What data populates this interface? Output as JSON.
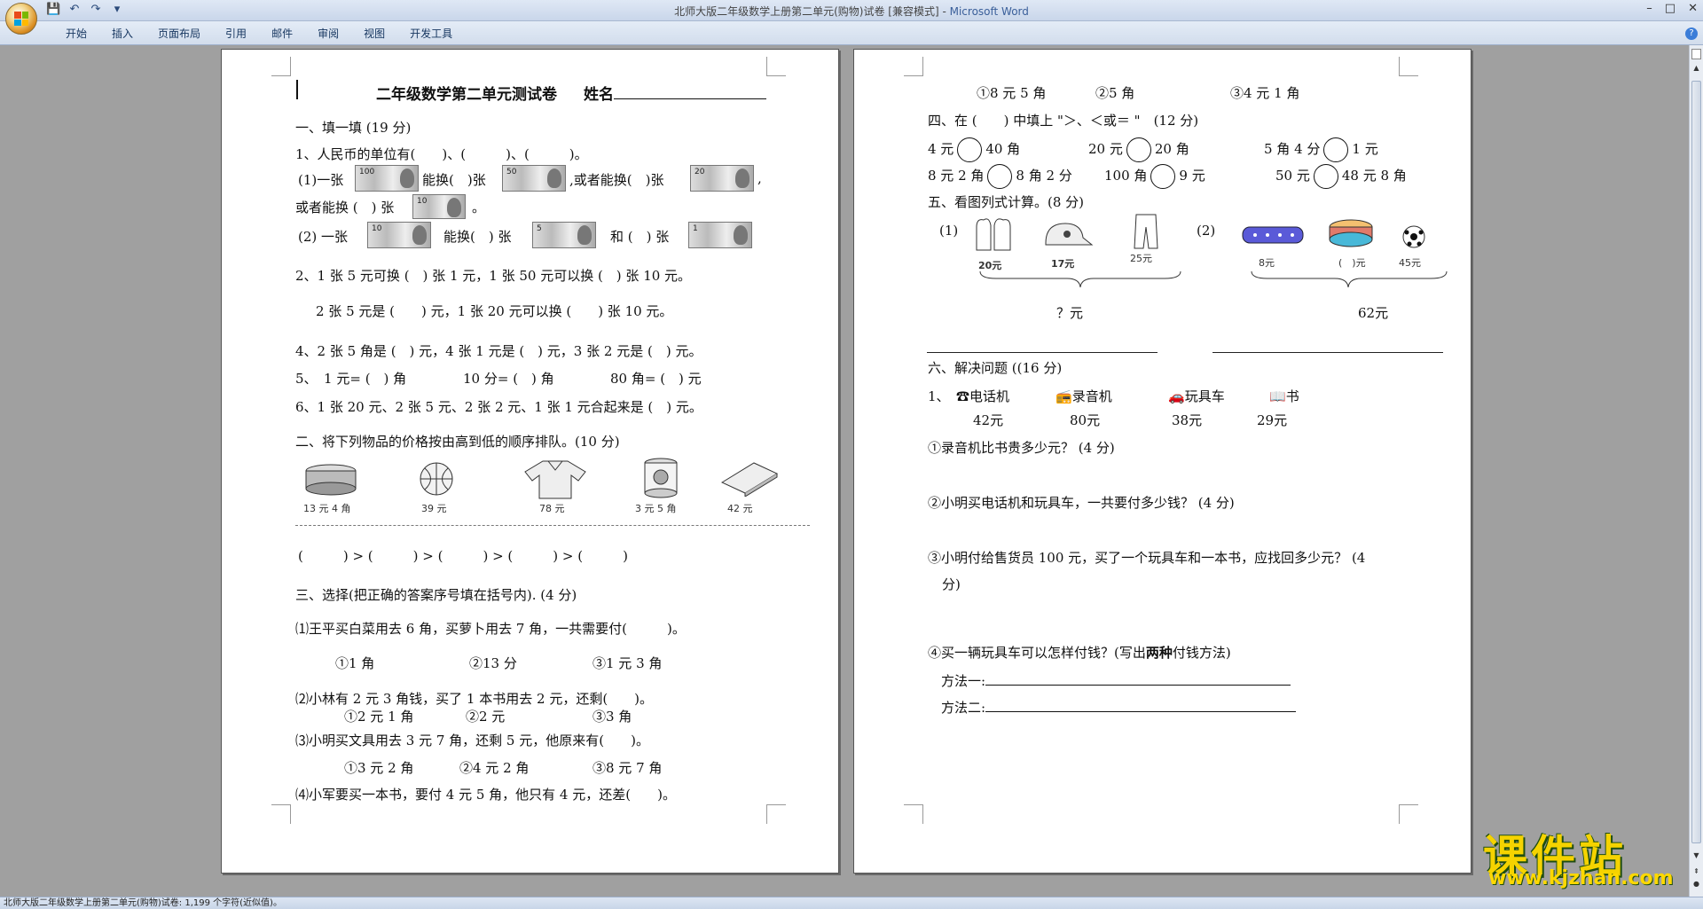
{
  "window": {
    "title": "北师大版二年级数学上册第二单元(购物)试卷 [兼容模式]",
    "app_name": "Microsoft Word",
    "separator": " - ",
    "controls": [
      "–",
      "□",
      "✕"
    ]
  },
  "quick_access": [
    {
      "icon": "save-icon",
      "glyph": "💾"
    },
    {
      "icon": "undo-icon",
      "glyph": "↶"
    },
    {
      "icon": "redo-icon",
      "glyph": "↷"
    },
    {
      "icon": "customize-icon",
      "glyph": "▾"
    }
  ],
  "ribbon_tabs": [
    "开始",
    "插入",
    "页面布局",
    "引用",
    "邮件",
    "审阅",
    "视图",
    "开发工具"
  ],
  "statusbar": {
    "text": "北师大版二年级数学上册第二单元(购物)试卷: 1,199 个字符(近似值)。"
  },
  "page1": {
    "title": "二年级数学第二单元测试卷",
    "name_label": "姓名",
    "s1_heading": "一、填一填 (19 分)",
    "q1": "1、人民币的单位有(　　)、(　　　)、(　　　)。",
    "q1_1a": "(1)一张",
    "q1_1b": "能换(　)张",
    "q1_1c": ",或者能换(　)张",
    "q1_1d": ",",
    "q1_1e": "或者能换 (　) 张",
    "q1_1f": "。",
    "q1_2a": "(2) 一张",
    "q1_2b": "能换(　) 张",
    "q1_2c": "和 (　) 张",
    "q2": "2、1 张 5 元可换 (　) 张 1 元，1 张 50 元可以换 (　) 张 10 元。",
    "q3": "2 张 5 元是 (　　) 元，1 张 20 元可以换 (　　) 张 10 元。",
    "q4": "4、2 张 5 角是 (　) 元，4 张 1 元是 (　) 元，3 张 2 元是 (　) 元。",
    "q5a": "5、　1 元= (　) 角",
    "q5b": "10 分= (　) 角",
    "q5c": "80 角= (　) 元",
    "q6": "6、1 张 20 元、2 张 5 元、2 张 2 元、1 张 1 元合起来是 (　) 元。",
    "s2_heading": "二、将下列物品的价格按由高到低的顺序排队。(10 分)",
    "items": [
      {
        "name": "can",
        "price": "13 元 4 角"
      },
      {
        "name": "basketball",
        "price": "39 元"
      },
      {
        "name": "shirt",
        "price": "78 元"
      },
      {
        "name": "milk-can",
        "price": "3 元 5 角"
      },
      {
        "name": "book-box",
        "price": "42 元"
      }
    ],
    "order_line": "(　　　) > (　　　) > (　　　) > (　　　) > (　　　)",
    "s3_heading": "三、选择(把正确的答案序号填在括号内). (4 分)",
    "c1": "⑴王平买白菜用去 6 角，买萝卜用去 7 角，一共需要付(　　　)。",
    "c1_opts": [
      "①1 角",
      "②13 分",
      "③1 元 3 角"
    ],
    "c2": "⑵小林有 2 元 3 角钱，买了 1 本书用去 2 元，还剩(　　)。",
    "c2_opts": [
      "①2 元 1 角",
      "②2 元",
      "③3 角"
    ],
    "c3": "⑶小明买文具用去 3 元 7 角，还剩 5 元，他原来有(　　)。",
    "c3_opts": [
      "①3 元 2 角",
      "②4 元 2 角",
      "③8 元 7 角"
    ],
    "c4": "⑷小军要买一本书，要付 4 元 5 角，他只有 4 元，还差(　　)。"
  },
  "page2": {
    "c4_opts": [
      "①8 元 5 角",
      "②5 角",
      "③4 元 1 角"
    ],
    "s4_heading": "四、在 (　　) 中填上 \"＞、＜或＝ \"　(12 分)",
    "cmp_row1": [
      [
        "4 元",
        "40 角"
      ],
      [
        "20 元",
        "20 角"
      ],
      [
        "5 角 4 分",
        "1 元"
      ]
    ],
    "cmp_row2": [
      [
        "8 元 2 角",
        "8 角 2 分"
      ],
      [
        "100 角",
        "9 元"
      ],
      [
        "50 元",
        "48 元 8 角"
      ]
    ],
    "s5_heading": "五、看图列式计算。(8 分)",
    "p1_label": "(1)",
    "p1_items": [
      {
        "name": "gloves",
        "price": "20元"
      },
      {
        "name": "cap",
        "price": "17元"
      },
      {
        "name": "pants",
        "price": "25元"
      }
    ],
    "p1_total": "？元",
    "p2_label": "(2)",
    "p2_items": [
      {
        "name": "pencil-case",
        "price": "8元"
      },
      {
        "name": "cake",
        "price": "(　)元"
      },
      {
        "name": "football",
        "price": "45元"
      }
    ],
    "p2_total": "62元",
    "s6_heading": "六、解决问题 ((16 分)",
    "s6_q_num": "1、",
    "s6_items": [
      {
        "name": "电话机",
        "icon": "phone-icon",
        "glyph": "☎",
        "price": "42元"
      },
      {
        "name": "录音机",
        "icon": "recorder-icon",
        "glyph": "📻",
        "price": "80元"
      },
      {
        "name": "玩具车",
        "icon": "toy-car-icon",
        "glyph": "🚗",
        "price": "38元"
      },
      {
        "name": "书",
        "icon": "book-icon",
        "glyph": "📖",
        "price": "29元"
      }
    ],
    "q6_1": "①录音机比书贵多少元？ (4 分)",
    "q6_2": "②小明买电话机和玩具车，一共要付多少钱？ (4 分)",
    "q6_3a": "③小明付给售货员 100 元，买了一个玩具车和一本书，应找回多少元？ (4",
    "q6_3b": "分)",
    "q6_4a": "④买一辆玩具车可以怎样付钱？(写出",
    "q6_4b": "两种",
    "q6_4c": "付钱方法)",
    "method1": "方法一:",
    "method2": "方法二:"
  },
  "watermark": {
    "cn": "课件站",
    "url": "www.kjzhan.com"
  }
}
